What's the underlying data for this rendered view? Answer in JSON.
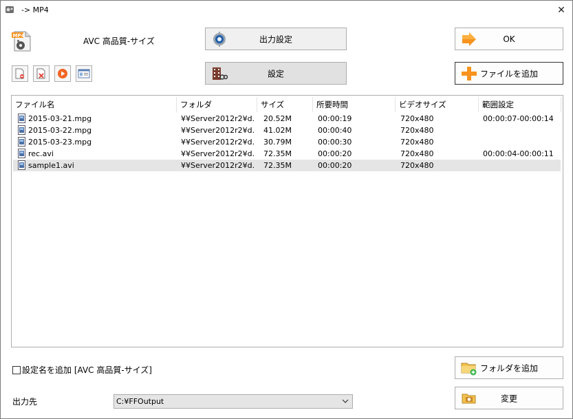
{
  "window": {
    "title": "-> MP4",
    "close_glyph": "✕"
  },
  "profile": {
    "name": "AVC 高品質-サイズ",
    "icon": "mp4-file-icon"
  },
  "buttons": {
    "output_settings": "出力設定",
    "settings": "設定",
    "ok": "OK",
    "add_file": "ファイルを追加",
    "add_folder": "フォルダを追加",
    "change": "変更"
  },
  "toolbar": {
    "icons": [
      "remove-item-icon",
      "clear-list-icon",
      "play-icon",
      "info-icon"
    ]
  },
  "list": {
    "columns": [
      "ファイル名",
      "フォルダ",
      "サイズ",
      "所要時間",
      "ビデオサイズ",
      "範囲設定"
    ],
    "rows": [
      {
        "name": "2015-03-21.mpg",
        "folder": "¥¥Server2012r2¥d...",
        "size": "20.52M",
        "duration": "00:00:19",
        "video_size": "720x480",
        "range": "00:00:07-00:00:14"
      },
      {
        "name": "2015-03-22.mpg",
        "folder": "¥¥Server2012r2¥d...",
        "size": "41.02M",
        "duration": "00:00:40",
        "video_size": "720x480",
        "range": ""
      },
      {
        "name": "2015-03-23.mpg",
        "folder": "¥¥Server2012r2¥d...",
        "size": "30.79M",
        "duration": "00:00:30",
        "video_size": "720x480",
        "range": ""
      },
      {
        "name": "rec.avi",
        "folder": "¥¥Server2012r2¥d...",
        "size": "72.35M",
        "duration": "00:00:20",
        "video_size": "720x480",
        "range": "00:00:04-00:00:11"
      },
      {
        "name": "sample1.avi",
        "folder": "¥¥Server2012r2¥d...",
        "size": "72.35M",
        "duration": "00:00:20",
        "video_size": "720x480",
        "range": ""
      }
    ],
    "selected_index": 4
  },
  "options": {
    "add_setting_name_label": "設定名を追加 [AVC 高品質-サイズ]",
    "add_setting_name_checked": false
  },
  "output": {
    "label": "出力先",
    "path": "C:¥FFOutput"
  },
  "colors": {
    "button_bg": "#f0f0f0",
    "selected_row": "#e5e5e5",
    "accent_orange": "#f7931e"
  }
}
